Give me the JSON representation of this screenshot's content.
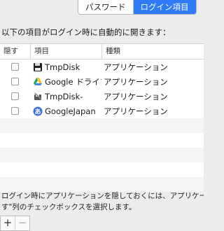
{
  "tabs": [
    {
      "label": "パスワード",
      "active": false
    },
    {
      "label": "ログイン項目",
      "active": true
    }
  ],
  "intro": "以下の項目がログイン時に自動的に開きます：",
  "table": {
    "headers": {
      "hide": "隠す",
      "item": "項目",
      "kind": "種類"
    },
    "rows": [
      {
        "name": "TmpDisk",
        "kind": "アプリケーション",
        "icon": "disk-icon",
        "hidden": false
      },
      {
        "name": "Google ドライブ",
        "kind": "アプリケーション",
        "icon": "google-drive-icon",
        "hidden": false
      },
      {
        "name": "TmpDisk-",
        "kind": "アプリケーション",
        "icon": "disk-tool-icon",
        "hidden": false
      },
      {
        "name": "GoogleJapan",
        "kind": "アプリケーション",
        "icon": "google-japan-icon",
        "hidden": false
      }
    ]
  },
  "help": {
    "line1": "ログイン時にアプリケーションを隠しておくには、アプリケーションの\"隠",
    "line2": "す\"列のチェックボックスを選択します。"
  },
  "buttons": {
    "add": "+",
    "remove": "−"
  },
  "colors": {
    "accent": "#2f7bf5"
  }
}
